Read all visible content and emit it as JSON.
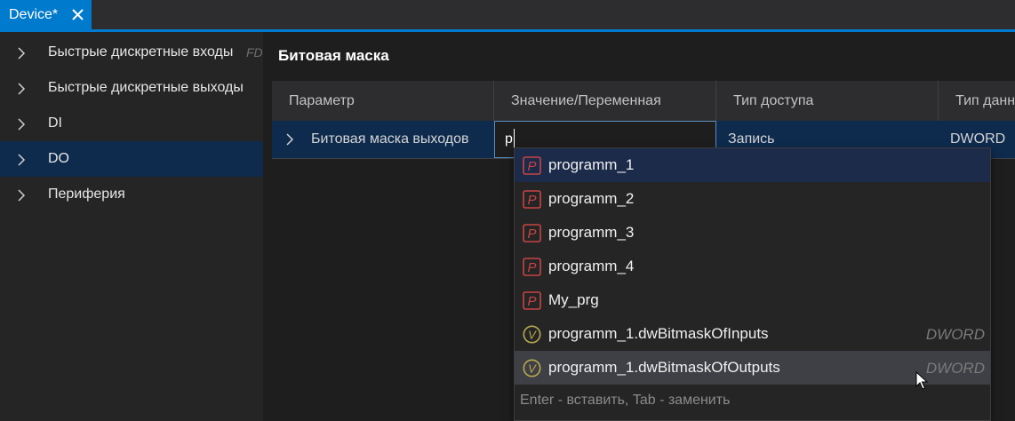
{
  "tab": {
    "title": "Device*"
  },
  "sidebar": {
    "items": [
      {
        "label": "Быстрые дискретные входы",
        "suffix": "FD"
      },
      {
        "label": "Быстрые дискретные выходы"
      },
      {
        "label": "DI"
      },
      {
        "label": "DO",
        "selected": true
      },
      {
        "label": "Периферия"
      }
    ]
  },
  "main": {
    "title": "Битовая маска",
    "columns": [
      "Параметр",
      "Значение/Переменная",
      "Тип доступа",
      "Тип данн"
    ],
    "row": {
      "parameter": "Битовая маска выходов",
      "value": "p",
      "access": "Запись",
      "datatype": "DWORD"
    }
  },
  "autocomplete": {
    "items": [
      {
        "icon": "P",
        "kind": "program",
        "label": "programm_1",
        "type": ""
      },
      {
        "icon": "P",
        "kind": "program",
        "label": "programm_2",
        "type": ""
      },
      {
        "icon": "P",
        "kind": "program",
        "label": "programm_3",
        "type": ""
      },
      {
        "icon": "P",
        "kind": "program",
        "label": "programm_4",
        "type": ""
      },
      {
        "icon": "P",
        "kind": "program",
        "label": "My_prg",
        "type": ""
      },
      {
        "icon": "V",
        "kind": "variable",
        "label": "programm_1.dwBitmaskOfInputs",
        "type": "DWORD"
      },
      {
        "icon": "V",
        "kind": "variable",
        "label": "programm_1.dwBitmaskOfOutputs",
        "type": "DWORD"
      }
    ],
    "hint": "Enter - вставить, Tab - заменить"
  },
  "colors": {
    "accent": "#007acc",
    "selection": "#0e2b4e",
    "program_icon": "#c74444",
    "variable_icon": "#b7a94d"
  }
}
